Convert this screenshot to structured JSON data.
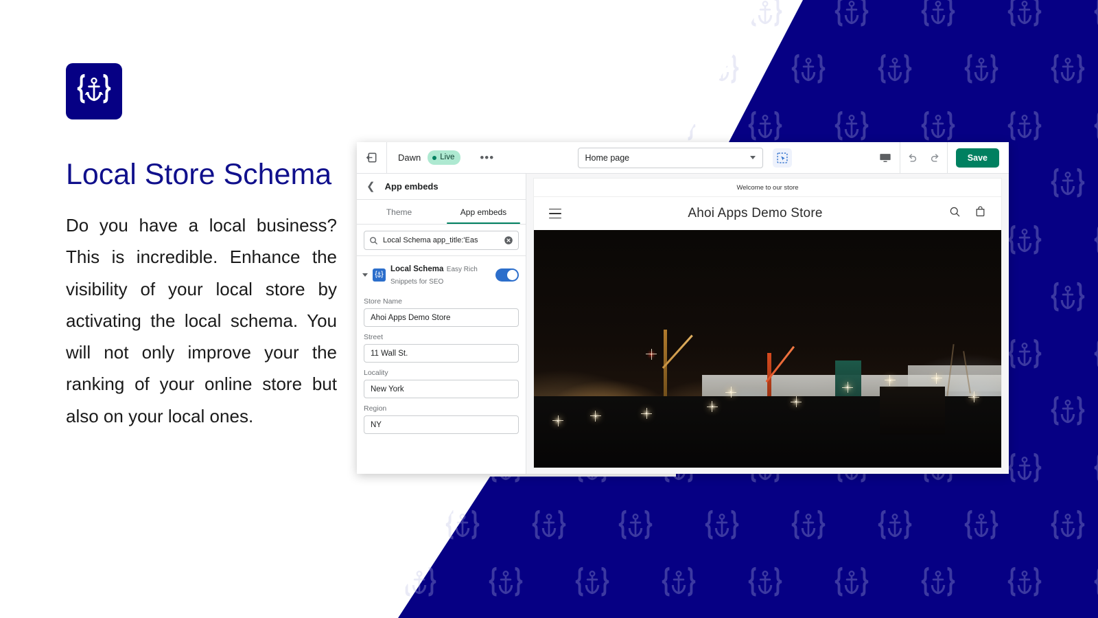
{
  "brand": {
    "logo_icon": "anchor-braces-logo",
    "navy": "#060084",
    "shopify_green": "#008060",
    "toggle_blue": "#2c6ecb"
  },
  "marketing": {
    "title": "Local Store Schema",
    "body": "Do you have a local business? This is incredible. Enhance the visibility of your local store by activating the local schema. You will not only improve your the ranking of your online store but also on your local ones."
  },
  "editor": {
    "topbar": {
      "exit_icon": "exit-to-left-icon",
      "theme_name": "Dawn",
      "status_badge": "Live",
      "more_label": "•••",
      "page_selector": {
        "value": "Home page",
        "caret_icon": "chevron-down-icon"
      },
      "inspector_icon": "section-select-icon",
      "device_icon": "desktop-monitor-icon",
      "undo_icon": "undo-arrow-icon",
      "redo_icon": "redo-arrow-icon",
      "save_label": "Save"
    },
    "sidebar": {
      "back_icon": "chevron-left-icon",
      "title": "App embeds",
      "tabs": [
        {
          "label": "Theme",
          "active": false
        },
        {
          "label": "App embeds",
          "active": true
        }
      ],
      "search": {
        "icon": "search-icon",
        "value": "Local Schema app_title:'Eas",
        "clear_icon": "clear-circle-icon"
      },
      "app": {
        "caret_icon": "caret-down-icon",
        "icon": "anchor-braces-app-icon",
        "name": "Local Schema",
        "subtitle": "Easy Rich Snippets for SEO",
        "toggle_on": true
      },
      "fields": [
        {
          "label": "Store Name",
          "value": "Ahoi Apps Demo Store"
        },
        {
          "label": "Street",
          "value": "11 Wall St."
        },
        {
          "label": "Locality",
          "value": "New York"
        },
        {
          "label": "Region",
          "value": "NY"
        }
      ]
    },
    "preview": {
      "announcement": "Welcome to our store",
      "menu_icon": "hamburger-menu-icon",
      "store_name": "Ahoi Apps Demo Store",
      "search_icon": "search-icon",
      "cart_icon": "shopping-bag-icon",
      "hero_alt": "night harbour shipyard with cranes and ships"
    }
  }
}
